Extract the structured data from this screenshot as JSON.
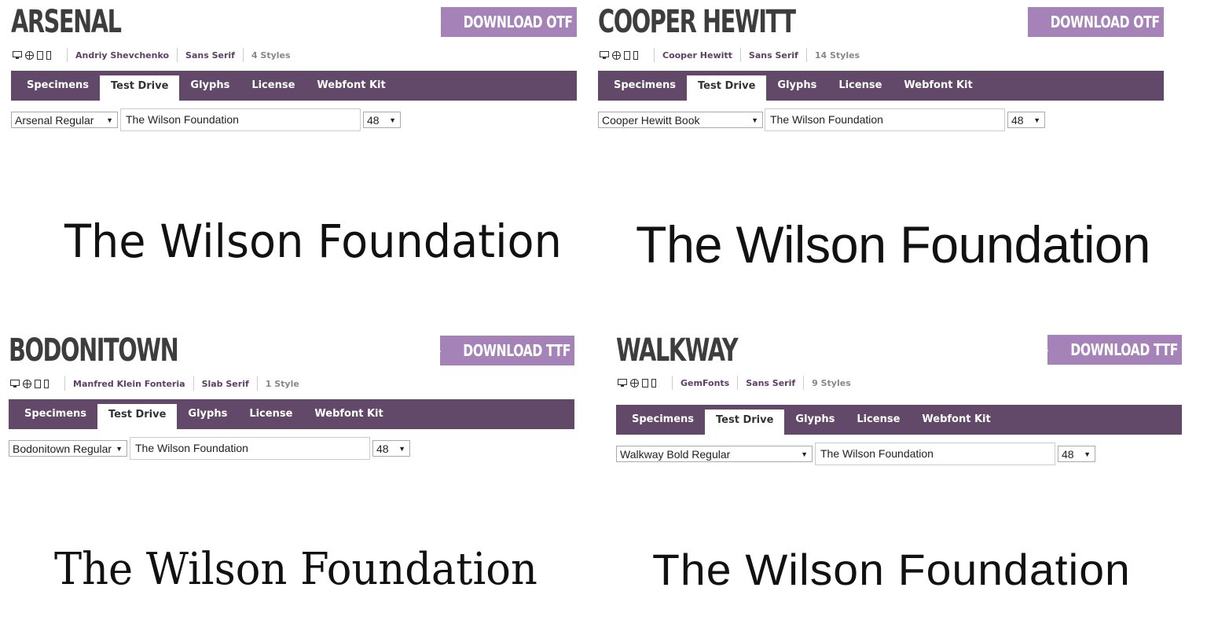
{
  "panels": [
    {
      "title": "ARSENAL",
      "download_label": "DOWNLOAD OTF",
      "author": "Andriy Shevchenko",
      "category": "Sans Serif",
      "styles": "4 Styles",
      "tabs": [
        "Specimens",
        "Test Drive",
        "Glyphs",
        "License",
        "Webfont Kit"
      ],
      "style_select": "Arsenal Regular",
      "sample_text": "The Wilson Foundation",
      "size_select": "48",
      "preview": "The Wilson Foundation"
    },
    {
      "title": "COOPER HEWITT",
      "download_label": "DOWNLOAD OTF",
      "author": "Cooper Hewitt",
      "category": "Sans Serif",
      "styles": "14 Styles",
      "tabs": [
        "Specimens",
        "Test Drive",
        "Glyphs",
        "License",
        "Webfont Kit"
      ],
      "style_select": "Cooper Hewitt Book",
      "sample_text": "The Wilson Foundation",
      "size_select": "48",
      "preview": "The Wilson Foundation"
    },
    {
      "title": "BODONITOWN",
      "download_label": "DOWNLOAD TTF",
      "author": "Manfred Klein Fonteria",
      "category": "Slab Serif",
      "styles": "1 Style",
      "tabs": [
        "Specimens",
        "Test Drive",
        "Glyphs",
        "License",
        "Webfont Kit"
      ],
      "style_select": "Bodonitown Regular",
      "sample_text": "The Wilson Foundation",
      "size_select": "48",
      "preview": "The Wilson Foundation"
    },
    {
      "title": "WALKWAY",
      "download_label": "DOWNLOAD TTF",
      "author": "GemFonts",
      "category": "Sans Serif",
      "styles": "9 Styles",
      "tabs": [
        "Specimens",
        "Test Drive",
        "Glyphs",
        "License",
        "Webfont Kit"
      ],
      "style_select": "Walkway Bold Regular",
      "sample_text": "The Wilson Foundation",
      "size_select": "48",
      "preview": "The Wilson Foundation"
    }
  ],
  "colors": {
    "accent": "#a582b7",
    "tab_bar": "#634969",
    "link": "#5d4066"
  },
  "icons": [
    "desktop-icon",
    "web-icon",
    "tablet-icon",
    "phone-icon",
    "download-arrow-icon",
    "dropdown-arrow-icon"
  ]
}
